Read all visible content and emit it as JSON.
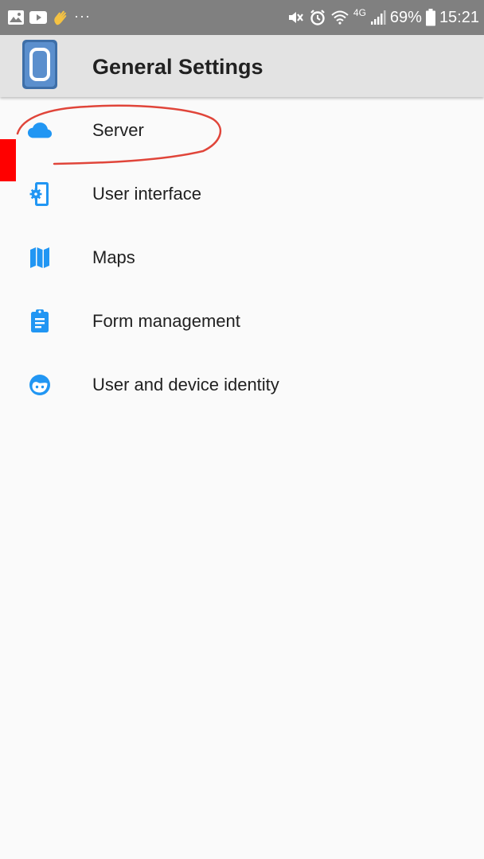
{
  "status_bar": {
    "left_icons": [
      "gallery-icon",
      "youtube-icon",
      "wave-hand-icon",
      "more-dots-icon"
    ],
    "more_indicator": "···",
    "network_type": "4G",
    "battery_percent": "69%",
    "time": "15:21"
  },
  "app_bar": {
    "title": "General Settings"
  },
  "settings": [
    {
      "label": "Server",
      "icon": "cloud-icon"
    },
    {
      "label": "User interface",
      "icon": "phone-settings-icon"
    },
    {
      "label": "Maps",
      "icon": "map-icon"
    },
    {
      "label": "Form management",
      "icon": "clipboard-icon"
    },
    {
      "label": "User and device identity",
      "icon": "face-icon"
    }
  ],
  "colors": {
    "status_bar": "#808080",
    "app_bar": "#e3e3e3",
    "background": "#fafafa",
    "icon_blue": "#2196f3",
    "annotation_red": "#e0453a",
    "arrow_red": "#ff0000"
  }
}
